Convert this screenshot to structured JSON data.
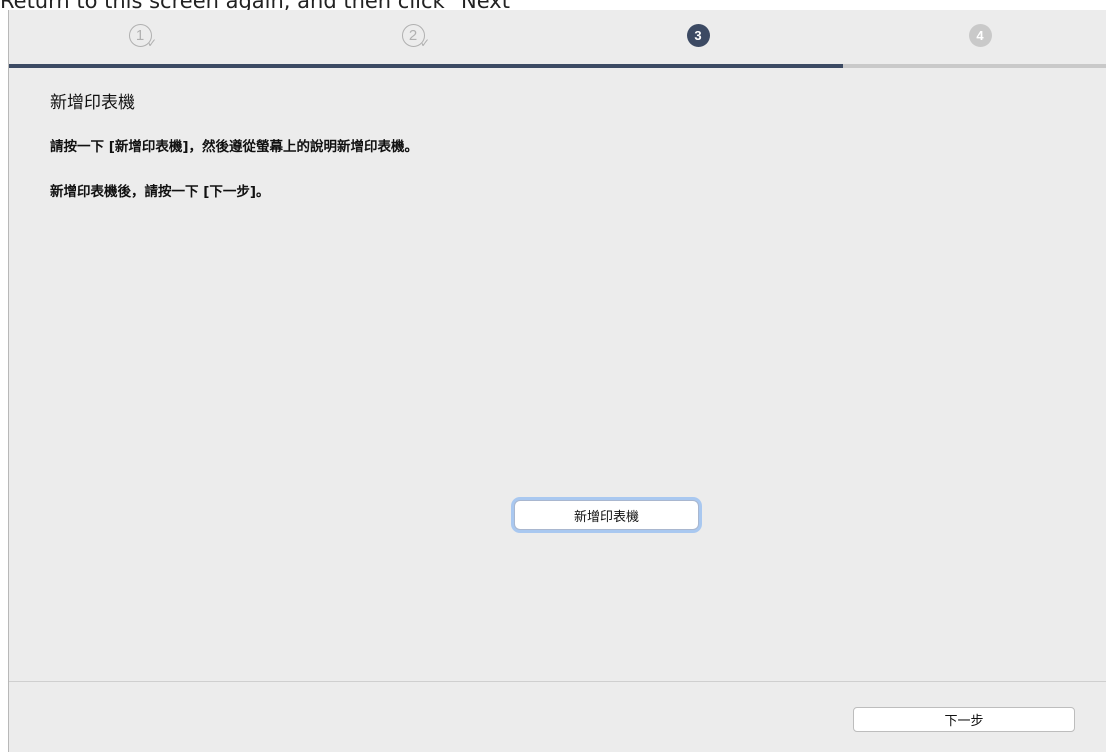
{
  "caption": "Return to this screen again, and then click \"Next\"",
  "steps": [
    {
      "label": "1",
      "state": "done",
      "icon": "check-icon"
    },
    {
      "label": "2",
      "state": "done",
      "icon": "check-icon"
    },
    {
      "label": "3",
      "state": "current"
    },
    {
      "label": "4",
      "state": "future"
    }
  ],
  "progress": {
    "completed_fraction": 0.76
  },
  "colors": {
    "accent": "#3c4a63",
    "inactive": "#c9c9c9",
    "background": "#ececec"
  },
  "content": {
    "title": "新增印表機",
    "instruction1": "請按一下 [新增印表機]，然後遵從螢幕上的說明新增印表機。",
    "instruction2": "新增印表機後，請按一下 [下一步]。"
  },
  "buttons": {
    "add_printer": "新增印表機",
    "next": "下一步"
  }
}
